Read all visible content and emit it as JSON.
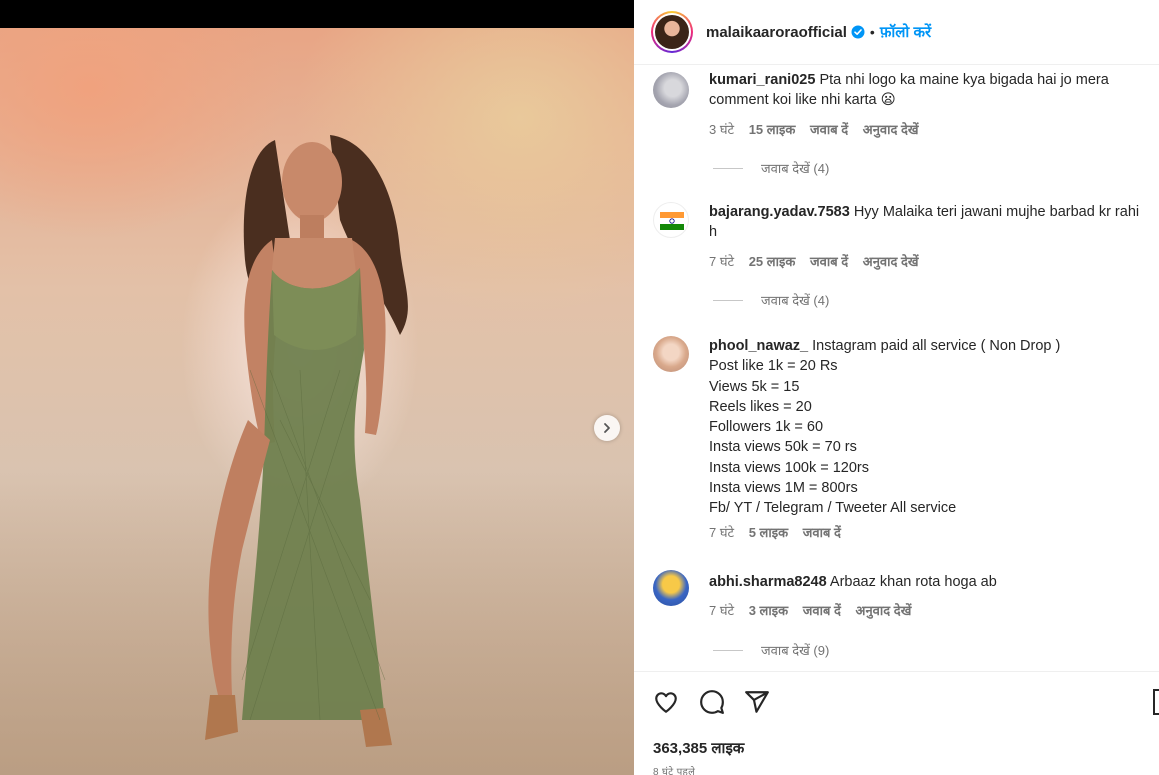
{
  "post": {
    "author": "malaikaaroraofficial",
    "follow_label": "फ़ॉलो करें",
    "separator": "•",
    "likes": "363,385 लाइक",
    "time_ago": "8 घंटे पहले"
  },
  "comments": [
    {
      "user": "kumari_rani025",
      "text": "Pta nhi logo ka maine kya bigada hai jo mera comment koi like nhi karta 😦",
      "time": "3 घंटे",
      "likes": "15 लाइक",
      "reply": "जवाब दें",
      "translate": "अनुवाद देखें",
      "view_replies": "जवाब देखें (4)"
    },
    {
      "user": "bajarang.yadav.7583",
      "text": "Hyy Malaika teri jawani mujhe barbad kr rahi h",
      "time": "7 घंटे",
      "likes": "25 लाइक",
      "reply": "जवाब दें",
      "translate": "अनुवाद देखें",
      "view_replies": "जवाब देखें (4)"
    },
    {
      "user": "phool_nawaz_",
      "text": "Instagram paid all service ( Non Drop )",
      "lines": [
        "Post like 1k = 20 Rs",
        "Views 5k = 15",
        "Reels likes = 20",
        "Followers 1k = 60",
        "Insta views 50k = 70 rs",
        "Insta views 100k = 120rs",
        "Insta views 1M = 800rs",
        "Fb/ YT / Telegram / Tweeter All service"
      ],
      "time": "7 घंटे",
      "likes": "5 लाइक",
      "reply": "जवाब दें"
    },
    {
      "user": "abhi.sharma8248",
      "text": "Arbaaz khan rota hoga ab",
      "time": "7 घंटे",
      "likes": "3 लाइक",
      "reply": "जवाब दें",
      "translate": "अनुवाद देखें",
      "view_replies": "जवाब देखें (9)"
    }
  ],
  "icons": {
    "verified": "verified-badge-icon",
    "like": "heart-icon",
    "comment": "comment-bubble-icon",
    "share": "paper-plane-icon",
    "save": "bookmark-icon",
    "next": "chevron-right-icon"
  },
  "colors": {
    "accent": "#0095f6",
    "text": "#262626",
    "muted": "#737373",
    "dress": "#6f7f4e"
  }
}
